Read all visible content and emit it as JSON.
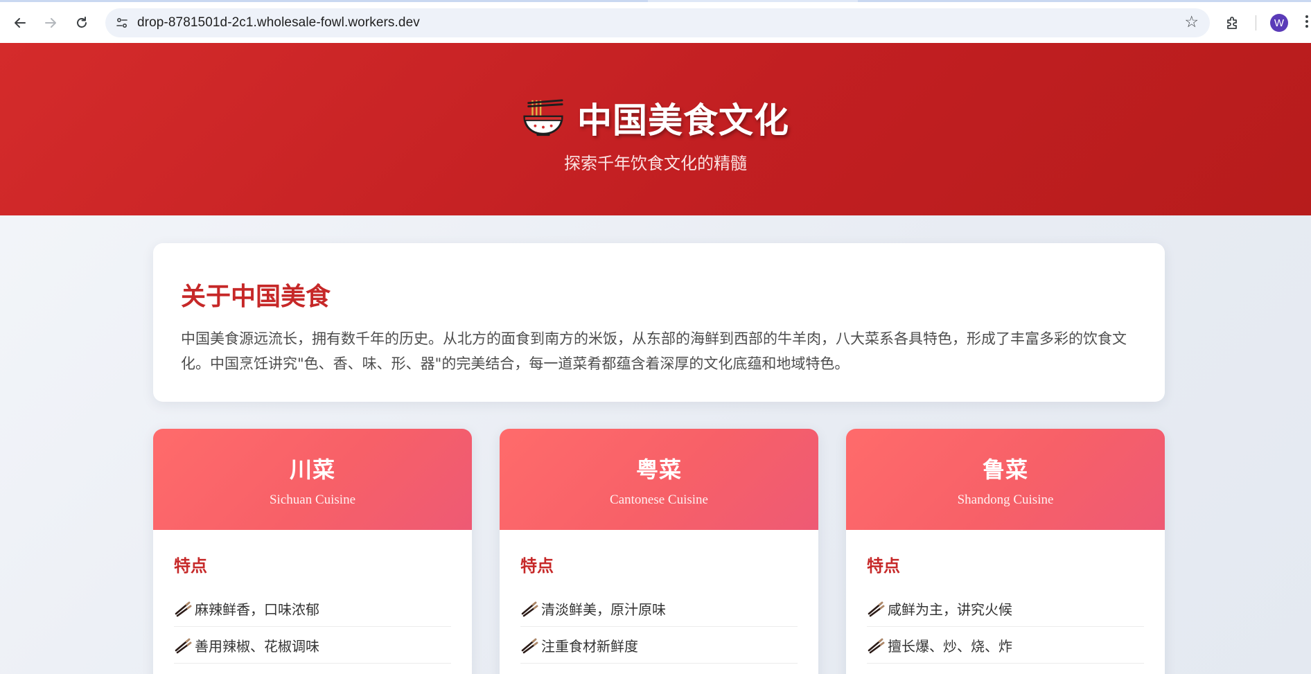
{
  "browser": {
    "url": "drop-8781501d-2c1.wholesale-fowl.workers.dev",
    "profile_initial": "W",
    "icons": {
      "back": "back-arrow-icon",
      "forward": "forward-arrow-icon",
      "reload": "reload-icon",
      "site_info": "site-info-icon",
      "bookmark": "star-icon",
      "extensions": "puzzle-icon",
      "menu": "more-vert-icon"
    }
  },
  "hero": {
    "icon": "noodle-bowl-icon",
    "title": "中国美食文化",
    "subtitle": "探索千年饮食文化的精髓"
  },
  "intro": {
    "heading": "关于中国美食",
    "text": "中国美食源远流长，拥有数千年的历史。从北方的面食到南方的米饭，从东部的海鲜到西部的牛羊肉，八大菜系各具特色，形成了丰富多彩的饮食文化。中国烹饪讲究\"色、香、味、形、器\"的完美结合，每一道菜肴都蕴含着深厚的文化底蕴和地域特色。"
  },
  "cuisines": [
    {
      "name_cn": "川菜",
      "name_en": "Sichuan Cuisine",
      "features_heading": "特点",
      "features": [
        "麻辣鲜香，口味浓郁",
        "善用辣椒、花椒调味"
      ]
    },
    {
      "name_cn": "粤菜",
      "name_en": "Cantonese Cuisine",
      "features_heading": "特点",
      "features": [
        "清淡鲜美，原汁原味",
        "注重食材新鲜度"
      ]
    },
    {
      "name_cn": "鲁菜",
      "name_en": "Shandong Cuisine",
      "features_heading": "特点",
      "features": [
        "咸鲜为主，讲究火候",
        "擅长爆、炒、烧、炸"
      ]
    }
  ],
  "feature_icon": "chopsticks-icon",
  "colors": {
    "hero_red": "#c62828",
    "card_gradient_start": "#ff6b6b",
    "card_gradient_end": "#ee5a74",
    "heading_red": "#c62828"
  }
}
